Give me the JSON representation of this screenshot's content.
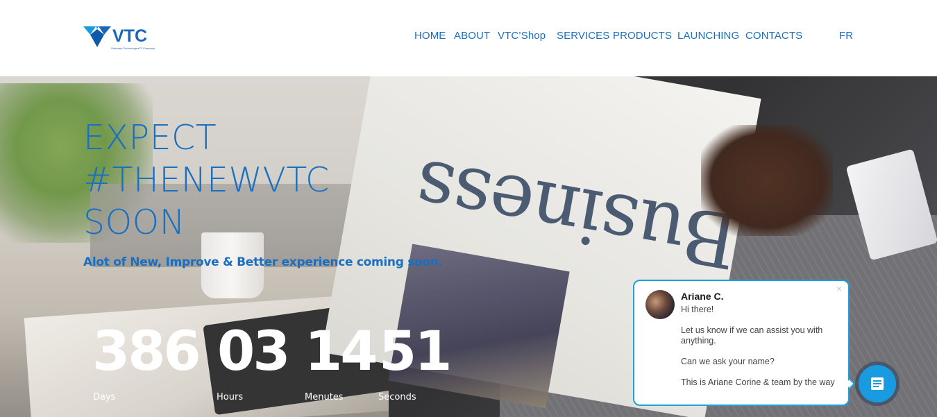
{
  "brand": {
    "logo_text": "VTC",
    "logo_tagline": "Visionary Technologies™ Company",
    "color": "#1a6fc0"
  },
  "nav": {
    "items": [
      "HOME",
      "ABOUT",
      "VTC’Shop",
      "SERVICES",
      "PRODUCTS",
      "LAUNCHING",
      "CONTACTS"
    ],
    "lang": "FR"
  },
  "hero": {
    "headline": [
      "EXPECT",
      "#THENEWVTC",
      "SOON"
    ],
    "subheadline": "Alot of New, Improve & Better experience coming soon.",
    "background_word": "Business"
  },
  "countdown": {
    "days": "386",
    "hours": "03",
    "minutes": "14",
    "seconds": "51",
    "labels": {
      "days": "Days",
      "hours": "Hours",
      "minutes": "Menutes",
      "seconds": "Seconds"
    }
  },
  "chat": {
    "close_icon": "×",
    "agent_name": "Ariane C.",
    "messages": [
      "Hi there!",
      "Let us know if we can assist you with anything.",
      "Can we ask your name?",
      "This is Ariane Corine & team by the way"
    ],
    "button_icon": "chat-lines-icon",
    "accent_color": "#1aa1e2"
  }
}
